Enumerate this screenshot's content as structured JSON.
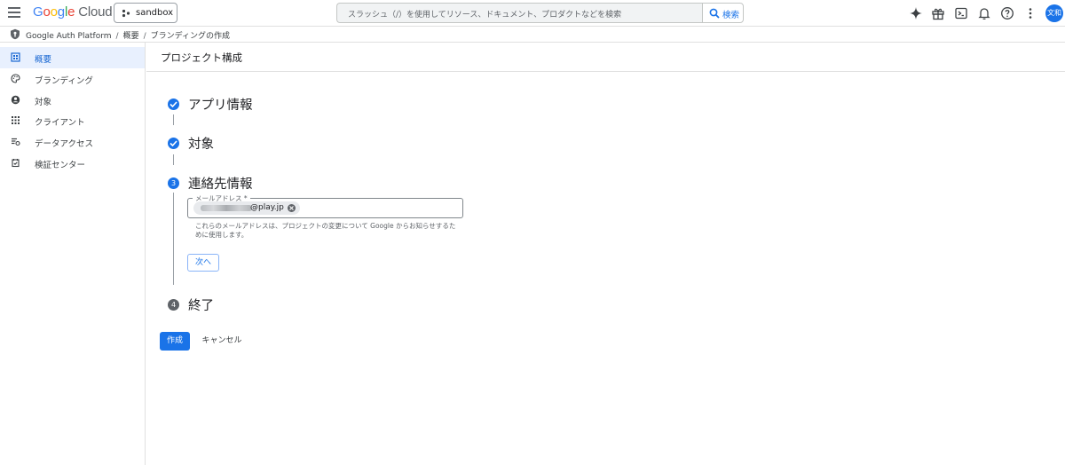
{
  "colors": {
    "accent": "#1a73e8",
    "step_pending": "#5f6368"
  },
  "header": {
    "logo_google": [
      "G",
      "o",
      "o",
      "g",
      "l",
      "e"
    ],
    "logo_cloud": "Cloud",
    "project": "sandbox",
    "search_placeholder": "スラッシュ（/）を使用してリソース、ドキュメント、プロダクトなどを検索",
    "search_button": "検索",
    "icons": [
      "gemini-sparkle-icon",
      "gift-icon",
      "cloud-shell-icon",
      "notifications-icon",
      "help-icon",
      "more-vert-icon"
    ],
    "avatar": "文和"
  },
  "breadcrumb": {
    "items": [
      "Google Auth Platform",
      "概要",
      "ブランディングの作成"
    ],
    "separator": "/"
  },
  "sidebar": {
    "items": [
      {
        "label": "概要",
        "icon": "dashboard-icon",
        "active": true
      },
      {
        "label": "ブランディング",
        "icon": "palette-icon",
        "active": false
      },
      {
        "label": "対象",
        "icon": "person-icon",
        "active": false
      },
      {
        "label": "クライアント",
        "icon": "grid-icon",
        "active": false
      },
      {
        "label": "データアクセス",
        "icon": "data-access-icon",
        "active": false
      },
      {
        "label": "検証センター",
        "icon": "verified-icon",
        "active": false
      }
    ]
  },
  "main": {
    "title": "プロジェクト構成",
    "steps": [
      {
        "label": "アプリ情報",
        "state": "done"
      },
      {
        "label": "対象",
        "state": "done"
      },
      {
        "number": "3",
        "label": "連絡先情報",
        "state": "active"
      },
      {
        "number": "4",
        "label": "終了",
        "state": "pending"
      }
    ],
    "email_field": {
      "label": "メールアドレス *",
      "chip_domain": "@play.jp",
      "helper": "これらのメールアドレスは、プロジェクトの変更について Google からお知らせするために使用します。"
    },
    "next_button": "次へ",
    "create_button": "作成",
    "cancel_button": "キャンセル"
  }
}
